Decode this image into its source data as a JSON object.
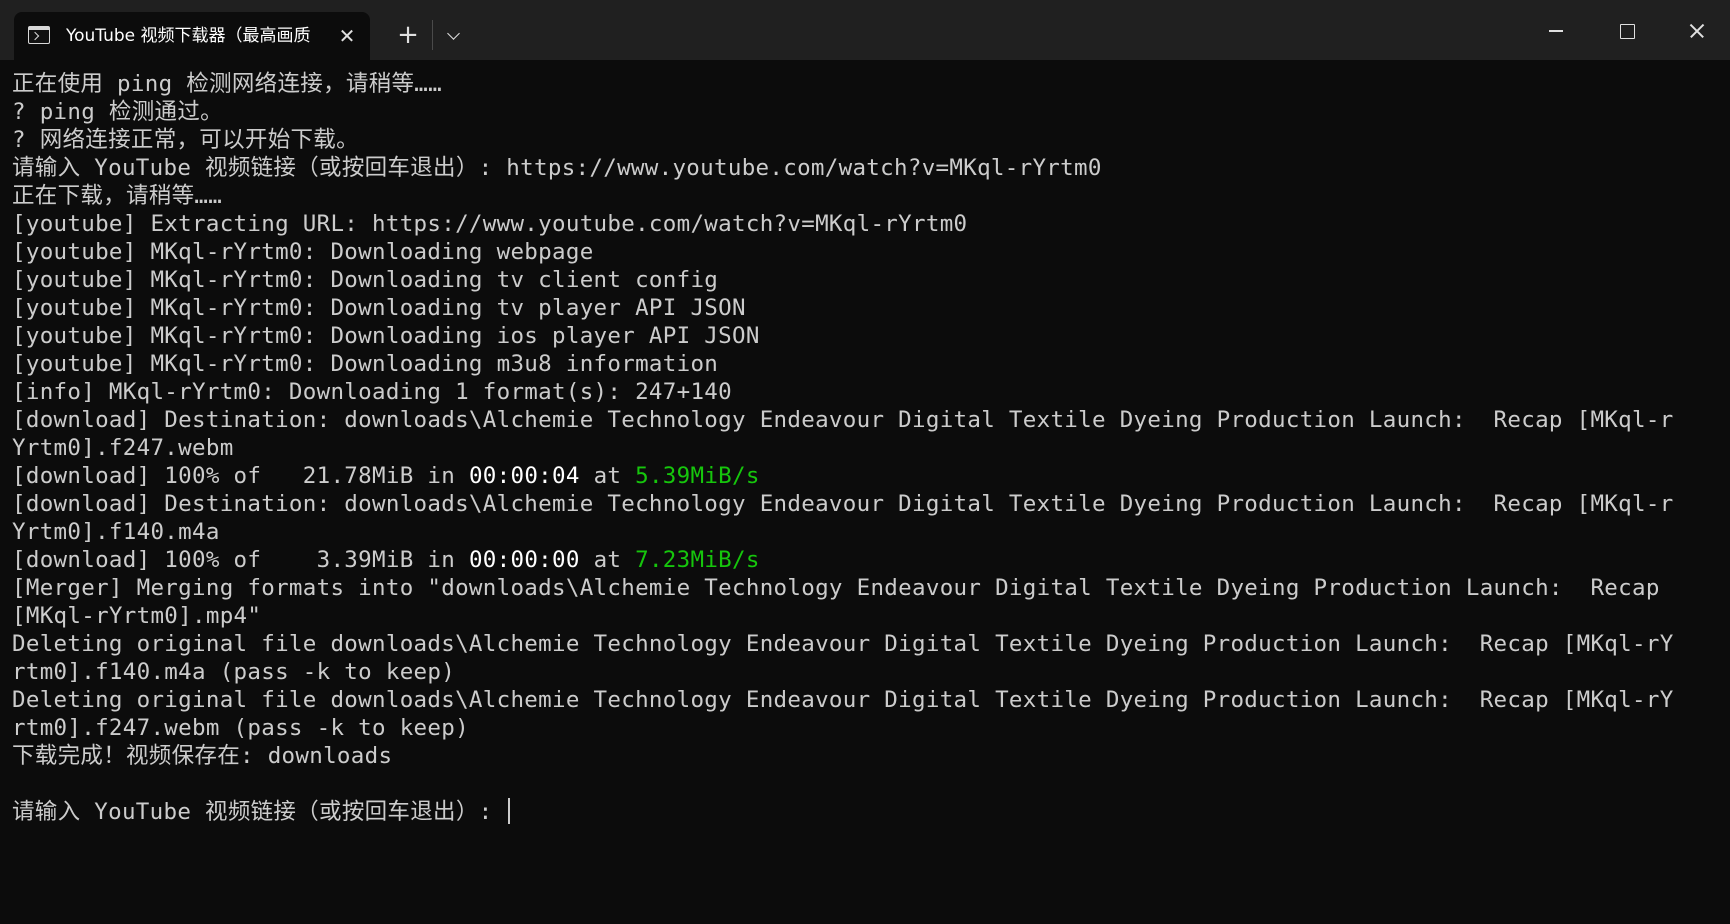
{
  "tab": {
    "title": "YouTube 视频下载器（最高画质",
    "icon": "terminal-icon"
  },
  "colors": {
    "background": "#0c0c0c",
    "titlebar": "#202020",
    "text": "#cccccc",
    "highlight": "#ffffff",
    "speed": "#16c60c"
  },
  "terminal": {
    "lines": [
      "正在使用 ping 检测网络连接，请稍等……",
      "? ping 检测通过。",
      "? 网络连接正常，可以开始下载。",
      "请输入 YouTube 视频链接（或按回车退出）: https://www.youtube.com/watch?v=MKql-rYrtm0",
      "正在下载，请稍等……",
      "[youtube] Extracting URL: https://www.youtube.com/watch?v=MKql-rYrtm0",
      "[youtube] MKql-rYrtm0: Downloading webpage",
      "[youtube] MKql-rYrtm0: Downloading tv client config",
      "[youtube] MKql-rYrtm0: Downloading tv player API JSON",
      "[youtube] MKql-rYrtm0: Downloading ios player API JSON",
      "[youtube] MKql-rYrtm0: Downloading m3u8 information",
      "[info] MKql-rYrtm0: Downloading 1 format(s): 247+140",
      "[download] Destination: downloads\\Alchemie Technology Endeavour Digital Textile Dyeing Production Launch:  Recap [MKql-r",
      "Yrtm0].f247.webm"
    ],
    "progress1": {
      "prefix": "[download] 100% of   21.78MiB in ",
      "time": "00:00:04",
      "at": " at ",
      "speed": "5.39MiB/s"
    },
    "lines2": [
      "[download] Destination: downloads\\Alchemie Technology Endeavour Digital Textile Dyeing Production Launch:  Recap [MKql-r",
      "Yrtm0].f140.m4a"
    ],
    "progress2": {
      "prefix": "[download] 100% of    3.39MiB in ",
      "time": "00:00:00",
      "at": " at ",
      "speed": "7.23MiB/s"
    },
    "lines3": [
      "[Merger] Merging formats into \"downloads\\Alchemie Technology Endeavour Digital Textile Dyeing Production Launch:  Recap",
      "[MKql-rYrtm0].mp4\"",
      "Deleting original file downloads\\Alchemie Technology Endeavour Digital Textile Dyeing Production Launch:  Recap [MKql-rY",
      "rtm0].f140.m4a (pass -k to keep)",
      "Deleting original file downloads\\Alchemie Technology Endeavour Digital Textile Dyeing Production Launch:  Recap [MKql-rY",
      "rtm0].f247.webm (pass -k to keep)",
      "下载完成！视频保存在: downloads",
      ""
    ],
    "prompt": "请输入 YouTube 视频链接（或按回车退出）: "
  }
}
